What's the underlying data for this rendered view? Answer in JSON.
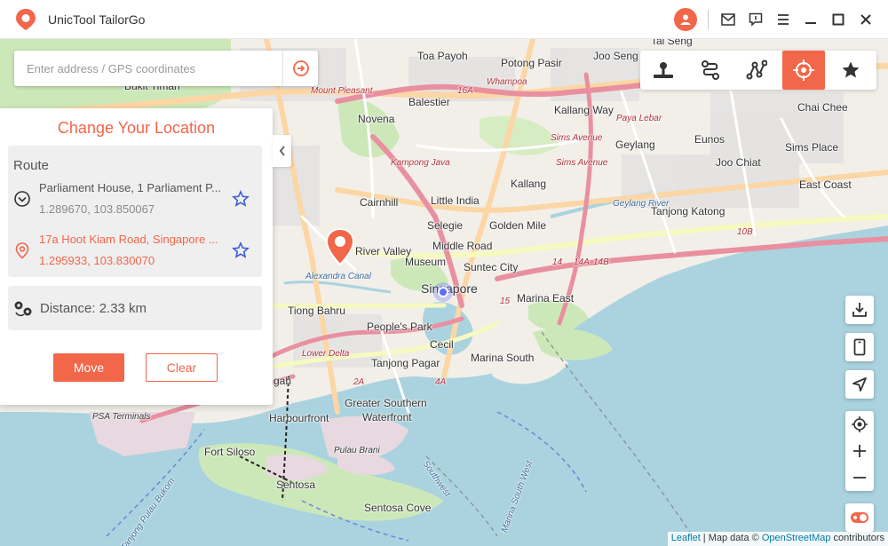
{
  "app": {
    "title": "UnicTool TailorGo"
  },
  "search": {
    "placeholder": "Enter address / GPS coordinates"
  },
  "panel": {
    "title": "Change Your Location",
    "route_label": "Route",
    "origin": {
      "name": "Parliament House, 1 Parliament P...",
      "coords": "1.289670, 103.850067"
    },
    "destination": {
      "name": "17a Hoot Kiam Road, Singapore ...",
      "coords": "1.295933, 103.830070"
    },
    "distance": "Distance: 2.33 km",
    "move_label": "Move",
    "clear_label": "Clear"
  },
  "map_labels": {
    "toa_payoh": "Toa Payoh",
    "potong_pasir": "Potong Pasir",
    "joo_seng": "Joo Seng",
    "tai_seng": "Tai Seng",
    "bukit_timah": "Bukit Timah",
    "mount_pleasant": "Mount Pleasant",
    "balestier": "Balestier",
    "kallang_way": "Kallang Way",
    "novena": "Novena",
    "chai_chee": "Chai Chee",
    "geylang": "Geylang",
    "eunos": "Eunos",
    "sims_avenue": "Sims Avenue",
    "paya_lebar": "Paya Lebar",
    "kampong_java": "Kampong Java",
    "joo_chiat": "Joo Chiat",
    "sims_place": "Sims Place",
    "kallang": "Kallang",
    "little_india": "Little India",
    "cairnhill": "Cairnhill",
    "east_coast": "East Coast",
    "tanjong_katong": "Tanjong Katong",
    "selegie": "Selegie",
    "golden_mile": "Golden Mile",
    "river_valley": "River Valley",
    "middle_road": "Middle Road",
    "museum": "Museum",
    "suntec_city": "Suntec City",
    "alexandra_canal": "Alexandra Canal",
    "singapore": "Singapore",
    "marina_east": "Marina East",
    "tiong_bahru": "Tiong Bahru",
    "peoples_park": "People's Park",
    "cecil": "Cecil",
    "lower_delta": "Lower Delta",
    "tanjong_pagar": "Tanjong Pagar",
    "marina_south": "Marina South",
    "greater_southern_waterfront_1": "Greater Southern",
    "greater_southern_waterfront_2": "Waterfront",
    "harbourfront": "Harbourfront",
    "psa_terminals": "PSA Terminals",
    "fort_siloso": "Fort Siloso",
    "pulau_brani": "Pulau Brani",
    "sentosa": "Sentosa",
    "sentosa_cove": "Sentosa Cove",
    "whampoa": "Whampoa",
    "sims_ave_road": "Sims Avenue",
    "gah": "gah",
    "southwest": "Southwest",
    "marina_south_west": "Marina South West",
    "tanjong_pulau_bukom": "Tanjong Pulau Bukom",
    "geylang_river": "Geylang River",
    "road_10b": "10B",
    "road_16a": "16A",
    "road_14": "14",
    "road_14a": "14A",
    "road_14b": "14B",
    "road_15": "15",
    "road_2a": "2A",
    "road_4a": "4A"
  },
  "attribution": {
    "leaflet": "Leaflet",
    "sep": " | Map data © ",
    "osm": "OpenStreetMap",
    "suffix": " contributors"
  },
  "colors": {
    "accent": "#f2664a",
    "water": "#aad3df",
    "route_star": "#3d5fd6",
    "current_location": "#5b6cff"
  }
}
